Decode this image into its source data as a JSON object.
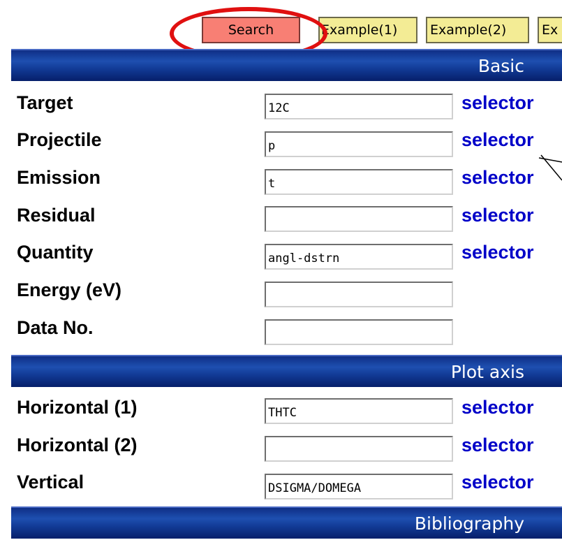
{
  "toolbar": {
    "search_label": "Search",
    "example1_label": "Example(1)",
    "example2_label": "Example(2)",
    "example3_label": "Ex"
  },
  "sections": {
    "basic": "Basic",
    "plot_axis": "Plot axis",
    "bibliography": "Bibliography"
  },
  "basic_fields": [
    {
      "label": "Target",
      "value": "12C",
      "selector": "selector"
    },
    {
      "label": "Projectile",
      "value": "p",
      "selector": "selector"
    },
    {
      "label": "Emission",
      "value": "t",
      "selector": "selector"
    },
    {
      "label": "Residual",
      "value": "",
      "selector": "selector"
    },
    {
      "label": "Quantity",
      "value": "angl-dstrn",
      "selector": "selector"
    },
    {
      "label": "Energy (eV)",
      "value": ""
    },
    {
      "label": "Data No.",
      "value": ""
    }
  ],
  "plot_fields": [
    {
      "label": "Horizontal (1)",
      "value": "THTC",
      "selector": "selector"
    },
    {
      "label": "Horizontal (2)",
      "value": "",
      "selector": "selector"
    },
    {
      "label": "Vertical",
      "value": "DSIGMA/DOMEGA",
      "selector": "selector"
    }
  ],
  "colors": {
    "search_button": "#f87f74",
    "example_button": "#f3ec95",
    "section_bar": "#123b96",
    "selector_link": "#0000c8",
    "highlight": "#e01010"
  }
}
